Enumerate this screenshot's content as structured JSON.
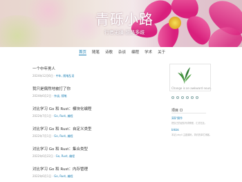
{
  "header": {
    "title": "青砾小路",
    "subtitle": "行者无疆 前路多歧"
  },
  "nav": {
    "items": [
      {
        "label": "首页",
        "active": true
      },
      {
        "label": "随笔"
      },
      {
        "label": "诗歌"
      },
      {
        "label": "杂谈"
      },
      {
        "label": "编程"
      },
      {
        "label": "学术"
      },
      {
        "label": "关于"
      }
    ]
  },
  "posts": [
    {
      "title": "一个中年男人",
      "date": "2024年12月6日",
      "tags": "中年, 随笔乱语"
    },
    {
      "title": "我只是偶然地被打了你",
      "date": "2024年6月2日",
      "tags": "杂谈, 随笔"
    },
    {
      "title": "对比学习 Go 和 Rust：模块化编程",
      "date": "2022年7月1日",
      "tags": "Go, Rust, 编程"
    },
    {
      "title": "对比学习 Go 和 Rust：自定义类型",
      "date": "2022年7月1日",
      "tags": "Go, Rust, 编程"
    },
    {
      "title": "对比学习 Go 和 Rust：集合类型",
      "date": "2022年6月22日",
      "tags": "Go, Rust, 编程"
    },
    {
      "title": "对比学习 Go 和 Rust：内存管理",
      "date": "2022年6月1日",
      "tags": "Go, Rust, 编程"
    }
  ],
  "sidebar": {
    "motto": "Change is an awkward noun.",
    "section_title": "项目",
    "items": [
      {
        "label": "采矿操作",
        "desc": "把自己的经验写成教程，汇总在此。"
      },
      {
        "label": "blkbk",
        "desc": "本站 Jekyll 主题源码，简约的单栏博客。"
      }
    ],
    "social_icons": [
      "rss-icon",
      "github-icon",
      "email-icon",
      "weibo-icon",
      "link-icon",
      "plus-icon"
    ]
  },
  "colors": {
    "accent": "#1a7fb4",
    "title_text": "#333333",
    "meta_text": "#999999",
    "petal": "#e0338a"
  }
}
